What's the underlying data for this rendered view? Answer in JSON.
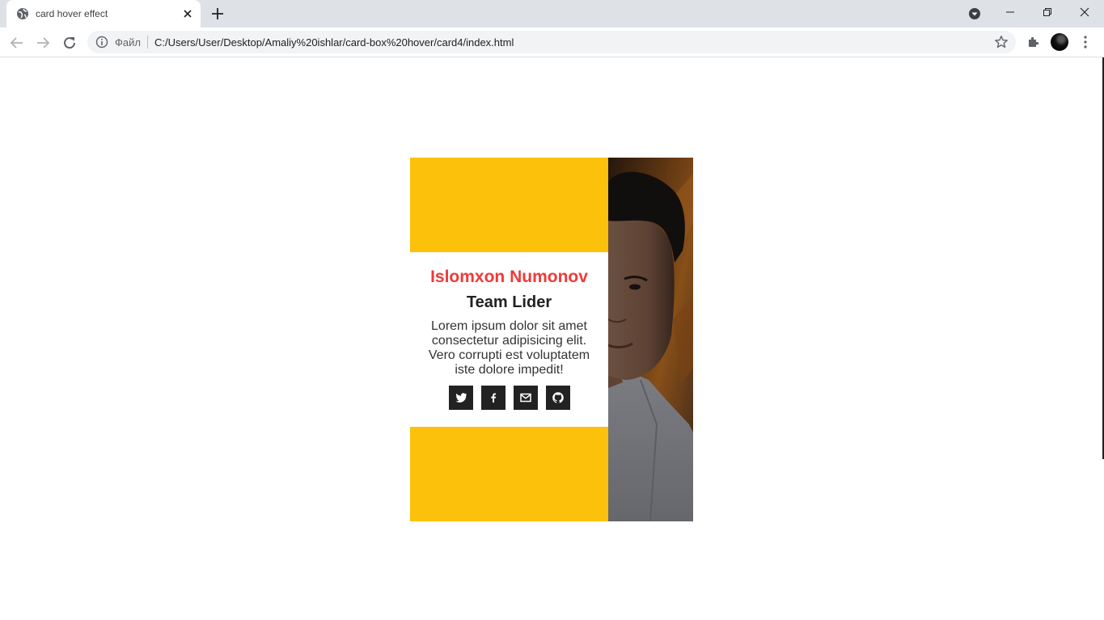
{
  "browser": {
    "tab_title": "card hover effect",
    "address_prefix": "Файл",
    "url": "C:/Users/User/Desktop/Amaliy%20ishlar/card-box%20hover/card4/index.html"
  },
  "card": {
    "name": "Islomxon Numonov",
    "role": "Team Lider",
    "description": "Lorem ipsum dolor sit amet consectetur adipisicing elit. Vero corrupti est voluptatem iste dolore impedit!",
    "socials": [
      "twitter-icon",
      "facebook-icon",
      "mail-icon",
      "github-icon"
    ],
    "accent_color": "#fcc10a",
    "name_color": "#ef3a3a"
  }
}
